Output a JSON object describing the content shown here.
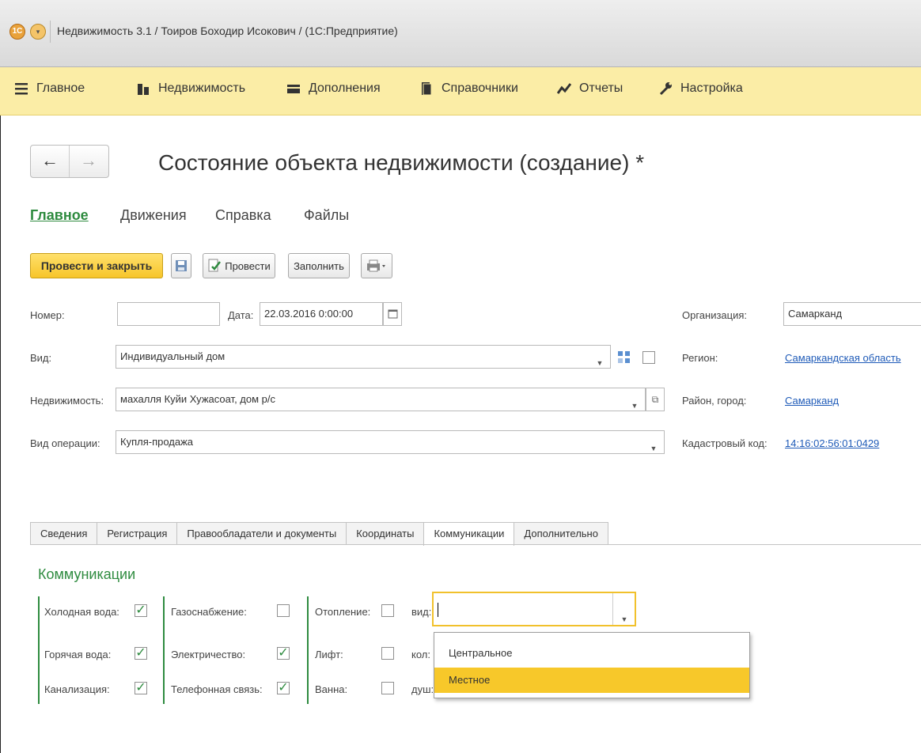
{
  "window": {
    "title": "Недвижимость 3.1 / Тоиров Боходир Исокович / (1С:Предприятие)",
    "logo_text": "1С"
  },
  "sections": [
    {
      "label": "Главное",
      "icon": "menu-lines-icon"
    },
    {
      "label": "Недвижимость",
      "icon": "buildings-icon"
    },
    {
      "label": "Дополнения",
      "icon": "box-icon"
    },
    {
      "label": "Справочники",
      "icon": "books-icon"
    },
    {
      "label": "Отчеты",
      "icon": "chart-line-icon"
    },
    {
      "label": "Настройка",
      "icon": "wrench-icon"
    }
  ],
  "form": {
    "title": "Состояние объекта недвижимости (создание) *",
    "nav": {
      "back": "←",
      "forward": "→"
    },
    "form_tabs": [
      "Главное",
      "Движения",
      "Справка",
      "Файлы"
    ],
    "toolbar": {
      "post_close": "Провести и закрыть",
      "post": "Провести",
      "fill": "Заполнить"
    },
    "fields": {
      "number_label": "Номер:",
      "number_value": "",
      "date_label": "Дата:",
      "date_value": "22.03.2016  0:00:00",
      "kind_label": "Вид:",
      "kind_value": "Индивидуальный дом",
      "property_label": "Недвижимость:",
      "property_value": "махалля Куйи Хужасоат, дом р/с",
      "operation_label": "Вид операции:",
      "operation_value": "Купля-продажа",
      "org_label": "Организация:",
      "org_value": "Самарканд",
      "region_label": "Регион:",
      "region_value": "Самаркандская область",
      "district_label": "Район, город:",
      "district_value": "Самарканд",
      "cadastral_label": "Кадастровый код:",
      "cadastral_value": "14:16:02:56:01:0429"
    },
    "tabs": [
      "Сведения",
      "Регистрация",
      "Правообладатели и документы",
      "Координаты",
      "Коммуникации",
      "Дополнительно"
    ],
    "active_tab": "Коммуникации",
    "communications": {
      "group_title": "Коммуникации",
      "cold_water": "Холодная вода:",
      "hot_water": "Горячая вода:",
      "sewage": "Канализация:",
      "gas": "Газоснабжение:",
      "electricity": "Электричество:",
      "phone": "Телефонная связь:",
      "heating": "Отопление:",
      "lift": "Лифт:",
      "bath": "Ванна:",
      "kind_label": "вид:",
      "count_label": "кол:",
      "shower_label": "душ:",
      "kind_value": "",
      "options": [
        "Центральное",
        "Местное"
      ],
      "selected_option": "Местное"
    }
  },
  "colors": {
    "accent_green": "#2e8b3f",
    "section_bar": "#fbeda6",
    "primary_button": "#f7c52a",
    "link": "#1f5bb8"
  }
}
